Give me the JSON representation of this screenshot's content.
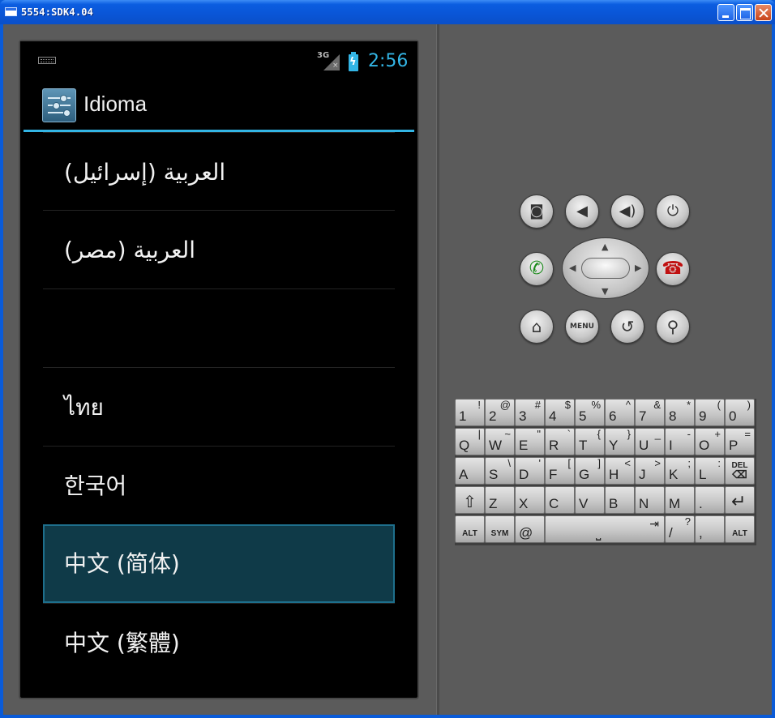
{
  "window": {
    "title": "5554:SDK4.04"
  },
  "statusbar": {
    "network": "3G",
    "clock": "2:56"
  },
  "actionbar": {
    "title": "Idioma"
  },
  "languages": [
    {
      "label": "العربية (إسرائيل)",
      "selected": false
    },
    {
      "label": "العربية (مصر)",
      "selected": false
    },
    {
      "label": "",
      "selected": false
    },
    {
      "label": "ไทย",
      "selected": false
    },
    {
      "label": "한국어",
      "selected": false
    },
    {
      "label": "中文 (简体)",
      "selected": true
    },
    {
      "label": "中文 (繁體)",
      "selected": false
    }
  ],
  "hardware": {
    "menu_label": "MENU",
    "icons": [
      "camera-icon",
      "volume-down-icon",
      "volume-up-icon",
      "power-icon",
      "call-icon",
      "end-call-icon",
      "home-icon",
      "back-icon",
      "search-icon"
    ]
  },
  "keyboard": {
    "row1": [
      {
        "k": "1",
        "a": "!"
      },
      {
        "k": "2",
        "a": "@"
      },
      {
        "k": "3",
        "a": "#"
      },
      {
        "k": "4",
        "a": "$"
      },
      {
        "k": "5",
        "a": "%"
      },
      {
        "k": "6",
        "a": "^"
      },
      {
        "k": "7",
        "a": "&"
      },
      {
        "k": "8",
        "a": "*"
      },
      {
        "k": "9",
        "a": "("
      },
      {
        "k": "0",
        "a": ")"
      }
    ],
    "row2": [
      {
        "k": "Q",
        "a": "|"
      },
      {
        "k": "W",
        "a": "~"
      },
      {
        "k": "E",
        "a": "\""
      },
      {
        "k": "R",
        "a": "`"
      },
      {
        "k": "T",
        "a": "{"
      },
      {
        "k": "Y",
        "a": "}"
      },
      {
        "k": "U",
        "a": "_"
      },
      {
        "k": "I",
        "a": "-"
      },
      {
        "k": "O",
        "a": "+"
      },
      {
        "k": "P",
        "a": "="
      }
    ],
    "row3": [
      {
        "k": "A",
        "a": ""
      },
      {
        "k": "S",
        "a": "\\"
      },
      {
        "k": "D",
        "a": "'"
      },
      {
        "k": "F",
        "a": "["
      },
      {
        "k": "G",
        "a": "]"
      },
      {
        "k": "H",
        "a": "<"
      },
      {
        "k": "J",
        "a": ">"
      },
      {
        "k": "K",
        "a": ";"
      },
      {
        "k": "L",
        "a": ":"
      },
      {
        "k": "DEL",
        "a": ""
      }
    ],
    "row4": [
      {
        "k": "⇧",
        "a": ""
      },
      {
        "k": "Z",
        "a": ""
      },
      {
        "k": "X",
        "a": ""
      },
      {
        "k": "C",
        "a": ""
      },
      {
        "k": "V",
        "a": ""
      },
      {
        "k": "B",
        "a": ""
      },
      {
        "k": "N",
        "a": ""
      },
      {
        "k": "M",
        "a": ""
      },
      {
        "k": ".",
        "a": ""
      },
      {
        "k": "↵",
        "a": ""
      }
    ],
    "row5": {
      "alt_left": "ALT",
      "sym": "SYM",
      "at": "@",
      "space_glyph": "⎵",
      "tab_glyph": "⇥",
      "slash": "/",
      "question": "?",
      "comma": ",",
      "alt_right": "ALT"
    }
  }
}
